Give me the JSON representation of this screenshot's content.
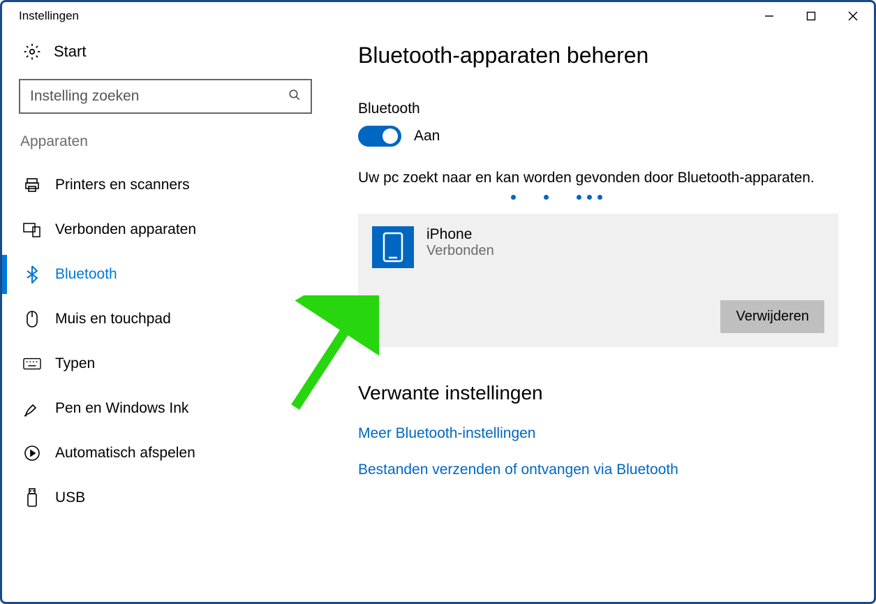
{
  "window": {
    "title": "Instellingen"
  },
  "sidebar": {
    "start": "Start",
    "search_placeholder": "Instelling zoeken",
    "category": "Apparaten",
    "items": [
      {
        "icon": "printer",
        "label": "Printers en scanners"
      },
      {
        "icon": "devices",
        "label": "Verbonden apparaten"
      },
      {
        "icon": "bluetooth",
        "label": "Bluetooth",
        "active": true
      },
      {
        "icon": "mouse",
        "label": "Muis en touchpad"
      },
      {
        "icon": "keyboard",
        "label": "Typen"
      },
      {
        "icon": "pen",
        "label": "Pen en Windows Ink"
      },
      {
        "icon": "autoplay",
        "label": "Automatisch afspelen"
      },
      {
        "icon": "usb",
        "label": "USB"
      }
    ]
  },
  "main": {
    "title": "Bluetooth-apparaten beheren",
    "toggle_section": "Bluetooth",
    "toggle_state": "Aan",
    "status": "Uw pc zoekt naar en kan worden gevonden door Bluetooth-apparaten.",
    "device": {
      "name": "iPhone",
      "status": "Verbonden",
      "remove": "Verwijderen"
    },
    "related_title": "Verwante instellingen",
    "related_links": [
      "Meer Bluetooth-instellingen",
      "Bestanden verzenden of ontvangen via Bluetooth"
    ]
  }
}
